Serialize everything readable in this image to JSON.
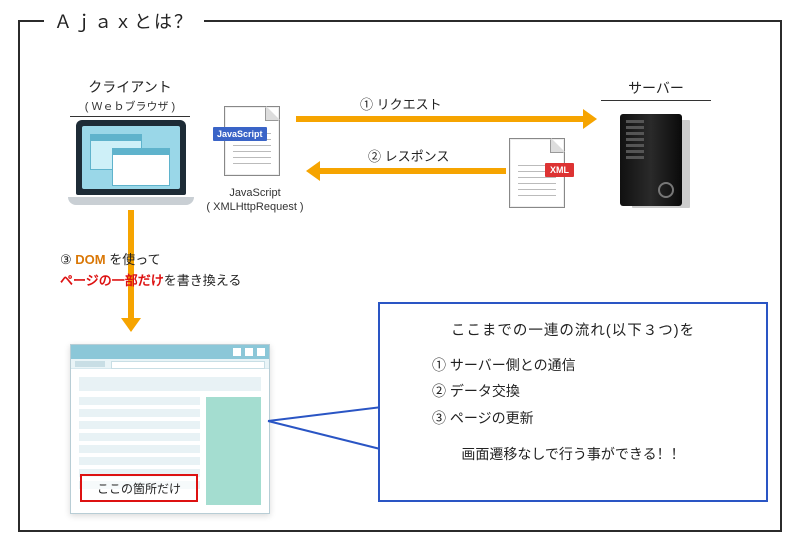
{
  "title": "Ａｊａｘとは？",
  "client": {
    "label": "クライアント",
    "sub": "( Ｗｅｂブラウザ )"
  },
  "server": {
    "label": "サーバー"
  },
  "js": {
    "badge": "JavaScript",
    "label1": "JavaScript",
    "label2": "( XMLHttpRequest )"
  },
  "xml": {
    "badge": "XML"
  },
  "arrows": {
    "request": "① リクエスト",
    "response": "② レスポンス"
  },
  "dom": {
    "line1_pre": "③ ",
    "line1_orange": "DOM",
    "line1_post": " を使って",
    "line2_red": "ページの一部だけ",
    "line2_post": "を書き換える"
  },
  "highlight": "ここの箇所だけ",
  "callout": {
    "title": "ここまでの一連の流れ(以下３つ)を",
    "items": [
      "① サーバー側との通信",
      "② データ交換",
      "③ ページの更新"
    ],
    "foot": "画面遷移なしで行う事ができる！！"
  }
}
